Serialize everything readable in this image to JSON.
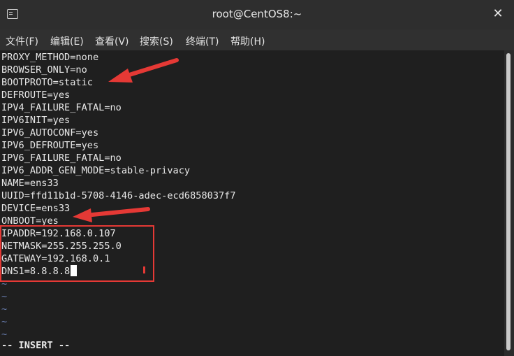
{
  "window": {
    "title": "root@CentOS8:~"
  },
  "menu": [
    "文件(F)",
    "编辑(E)",
    "查看(V)",
    "搜索(S)",
    "终端(T)",
    "帮助(H)"
  ],
  "lines": [
    "PROXY_METHOD=none",
    "BROWSER_ONLY=no",
    "BOOTPROTO=static",
    "DEFROUTE=yes",
    "IPV4_FAILURE_FATAL=no",
    "IPV6INIT=yes",
    "IPV6_AUTOCONF=yes",
    "IPV6_DEFROUTE=yes",
    "IPV6_FAILURE_FATAL=no",
    "IPV6_ADDR_GEN_MODE=stable-privacy",
    "NAME=ens33",
    "UUID=ffd11b1d-5708-4146-adec-ecd6858037f7",
    "DEVICE=ens33",
    "ONBOOT=yes",
    "IPADDR=192.168.0.107",
    "NETMASK=255.255.255.0",
    "GATEWAY=192.168.0.1",
    "DNS1=8.8.8.8"
  ],
  "tildes": [
    "~",
    "~",
    "~",
    "~",
    "~"
  ],
  "status": "-- INSERT --",
  "colors": {
    "annotation": "#e53935",
    "tilde": "#6a7fb2"
  }
}
